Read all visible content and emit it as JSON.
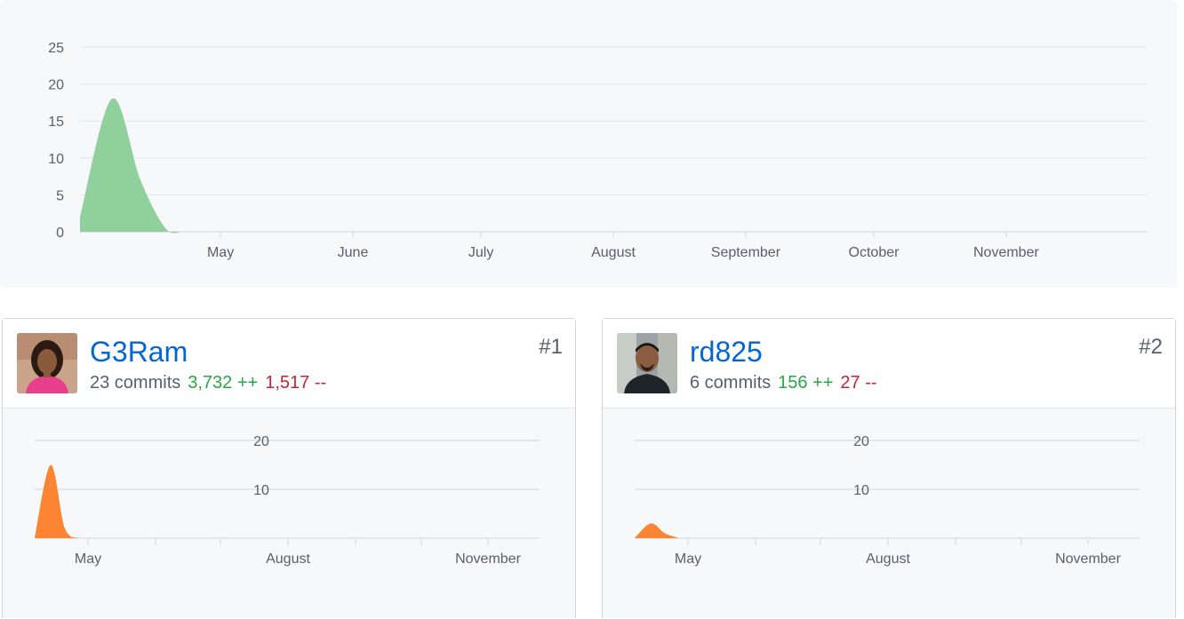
{
  "colors": {
    "main_area": "#90d09c",
    "contributor_area": "#fb8532",
    "username": "#0366d6",
    "additions": "#28a745",
    "deletions": "#cb2431",
    "muted": "#586069",
    "panel_bg": "#f6f8fa"
  },
  "chart_data": [
    {
      "type": "area",
      "y_ticks": [
        "25",
        "20",
        "15",
        "10",
        "5",
        "0"
      ],
      "ylim": [
        0,
        27
      ],
      "x_tick_labels": [
        "May",
        "June",
        "July",
        "August",
        "September",
        "October",
        "November"
      ],
      "grid": true,
      "series": [
        {
          "x": [
            "Apr 1",
            "Apr 8",
            "Apr 15",
            "Apr 22",
            "Apr 29"
          ],
          "values": [
            2,
            18,
            7,
            0.5,
            0
          ]
        }
      ]
    },
    {
      "type": "area",
      "y_ticks": [
        "20",
        "10"
      ],
      "ylim": [
        0,
        20
      ],
      "x_tick_labels": [
        "May",
        "August",
        "November"
      ],
      "series": [
        {
          "x": [
            "Apr 8",
            "Apr 15",
            "Apr 22",
            "Apr 29"
          ],
          "values": [
            2,
            15,
            2,
            0
          ]
        }
      ]
    },
    {
      "type": "area",
      "y_ticks": [
        "20",
        "10"
      ],
      "ylim": [
        0,
        20
      ],
      "x_tick_labels": [
        "May",
        "August",
        "November"
      ],
      "series": [
        {
          "x": [
            "Apr 8",
            "Apr 15",
            "Apr 22",
            "Apr 29"
          ],
          "values": [
            1.5,
            3,
            1,
            0
          ]
        }
      ]
    }
  ],
  "contributors": [
    {
      "username": "G3Ram",
      "commits": "23 commits",
      "additions": "3,732 ++",
      "deletions": "1,517 --",
      "rank": "#1",
      "avatar_icon": "avatar-woman-icon"
    },
    {
      "username": "rd825",
      "commits": "6 commits",
      "additions": "156 ++",
      "deletions": "27 --",
      "rank": "#2",
      "avatar_icon": "avatar-man-icon"
    }
  ]
}
